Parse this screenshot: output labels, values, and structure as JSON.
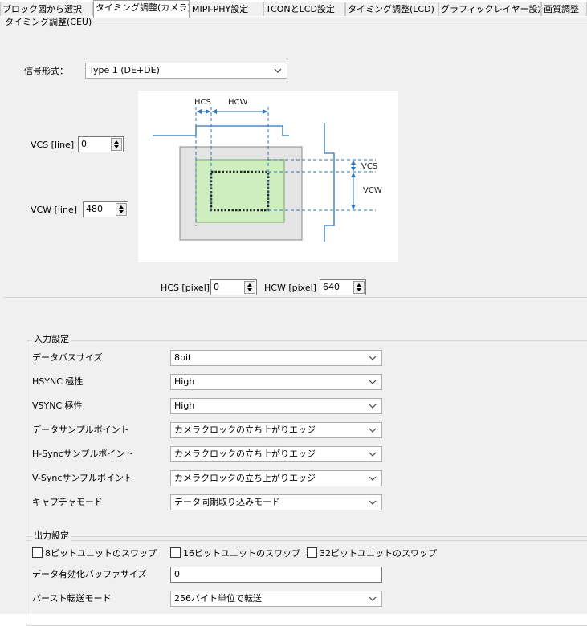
{
  "tabs": [
    {
      "label": "ブロック図から選択",
      "active": false
    },
    {
      "label": "タイミング調整(カメラ)",
      "active": true
    },
    {
      "label": "MIPI-PHY設定",
      "active": false
    },
    {
      "label": "TCONとLCD設定",
      "active": false
    },
    {
      "label": "タイミング調整(LCD)",
      "active": false
    },
    {
      "label": "グラフィックレイヤー設定",
      "active": false
    },
    {
      "label": "画質調整",
      "active": false
    }
  ],
  "ceu": {
    "group_title": "タイミング調整(CEU)",
    "signal_label": "信号形式：",
    "signal_value": "Type 1 (DE+DE)",
    "vcs_label": "VCS [line]",
    "vcs_value": "0",
    "vcw_label": "VCW [line]",
    "vcw_value": "480",
    "hcs_label": "HCS [pixel]",
    "hcs_value": "0",
    "hcw_label": "HCW [pixel]",
    "hcw_value": "640",
    "diagram": {
      "hcs": "HCS",
      "hcw": "HCW",
      "vcs": "VCS",
      "vcw": "VCW"
    }
  },
  "input": {
    "group_title": "入力設定",
    "rows": [
      {
        "label": "データバスサイズ",
        "value": "8bit"
      },
      {
        "label": "HSYNC 極性",
        "value": "High"
      },
      {
        "label": "VSYNC 極性",
        "value": "High"
      },
      {
        "label": "データサンプルポイント",
        "value": "カメラクロックの立ち上がりエッジ"
      },
      {
        "label": "H-Syncサンプルポイント",
        "value": "カメラクロックの立ち上がりエッジ"
      },
      {
        "label": "V-Syncサンプルポイント",
        "value": "カメラクロックの立ち上がりエッジ"
      },
      {
        "label": "キャプチャモード",
        "value": "データ同期取り込みモード"
      }
    ]
  },
  "output": {
    "group_title": "出力設定",
    "checks": [
      {
        "label": "8ビットユニットのスワップ",
        "checked": false
      },
      {
        "label": "16ビットユニットのスワップ",
        "checked": false
      },
      {
        "label": "32ビットユニットのスワップ",
        "checked": false
      }
    ],
    "buffer_label": "データ有効化バッファサイズ",
    "buffer_value": "0",
    "burst_label": "バースト転送モード",
    "burst_value": "256バイト単位で転送"
  },
  "colors": {
    "accent_line": "#2e75b6",
    "sensor_fill": "#cfeec0",
    "frame_fill": "#e4e4e4"
  }
}
